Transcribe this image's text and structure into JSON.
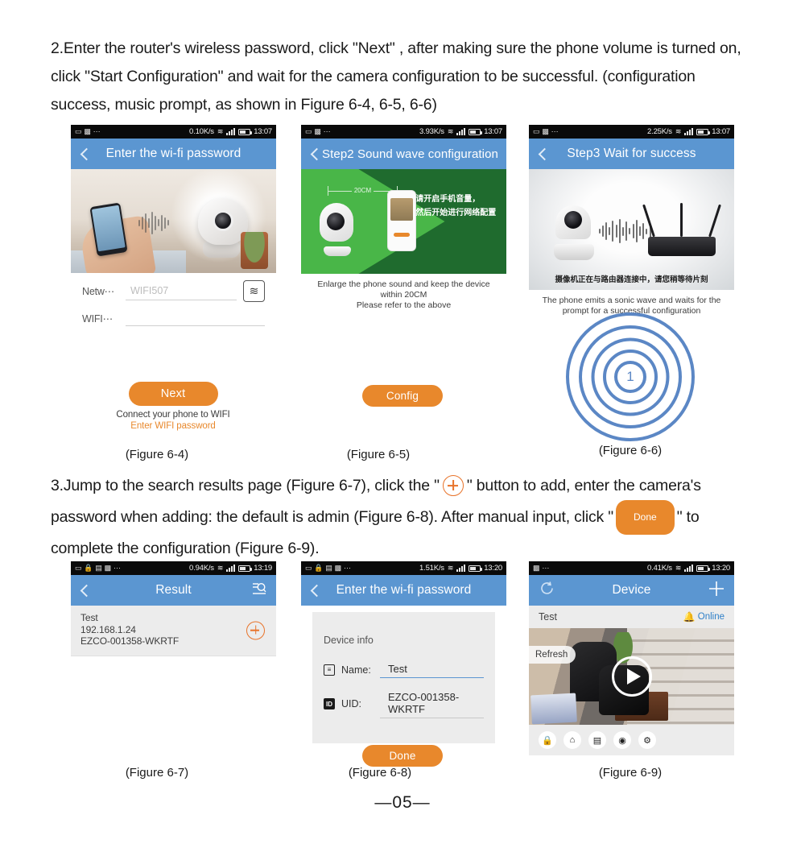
{
  "paragraphs": {
    "p2_a": "2.Enter the router's wireless password, click \"Next\" , after making sure the phone volume is turned on, click \"Start Configuration\" and wait for the camera configuration to be successful. (configuration success, music prompt, as shown in Figure 6-4, 6-5, 6-6)",
    "p3_a": "3.Jump to the search results page (Figure 6-7), click the \"",
    "p3_b": "\" button to add, enter the camera's password when adding: the default is admin (Figure 6-8). After manual input, click \"",
    "p3_done": "Done",
    "p3_c": "\" to complete the configuration  (Figure 6-9)."
  },
  "page_number": "05",
  "colors": {
    "nav_blue": "#5b96d1",
    "accent_orange": "#e8882c",
    "plus_orange": "#e8732a",
    "ripple_blue": "#5b87c5",
    "green_light": "#49b648",
    "green_dark": "#1f6b2e"
  },
  "figures": {
    "fig64": {
      "caption": "(Figure 6-4)",
      "statusbar": {
        "rate": "0.10K/s",
        "time": "13:07",
        "wifi_icon": "wifi-icon",
        "signal_icon": "signal-bars-icon",
        "battery_icon": "battery-icon"
      },
      "navbar": {
        "title": "Enter the wi-fi password",
        "back_icon": "back-chevron-icon"
      },
      "form": {
        "row1_label": "Netw⋯",
        "row1_value": "WIFI507",
        "row1_button_icon": "wifi-scan-icon",
        "row2_label": "WIFI⋯",
        "row2_value": ""
      },
      "cta": {
        "label": "Next",
        "sub1": "Connect your phone to WIFI",
        "sub2": "Enter WIFI password"
      }
    },
    "fig65": {
      "caption": "(Figure 6-5)",
      "statusbar": {
        "rate": "3.93K/s",
        "time": "13:07"
      },
      "navbar": {
        "title": "Step2 Sound wave configuration",
        "back_icon": "back-chevron-icon"
      },
      "panel": {
        "distance_label": "20CM",
        "cn_line1": "请开启手机音量，",
        "cn_line2": "然后开始进行网络配置"
      },
      "caption_lines": [
        "Enlarge the phone sound and keep the device within 20CM",
        "Please refer to the above"
      ],
      "cta": {
        "label": "Config"
      }
    },
    "fig66": {
      "caption": "(Figure 6-6)",
      "statusbar": {
        "rate": "2.25K/s",
        "time": "13:07"
      },
      "navbar": {
        "title": "Step3 Wait for success",
        "back_icon": "back-chevron-icon"
      },
      "panel": {
        "cn_line": "摄像机正在与路由器连接中，请您稍等待片刻"
      },
      "caption_lines": [
        "The phone emits a sonic wave and waits for the",
        "prompt for a successful configuration"
      ],
      "ripple_number": "1"
    },
    "fig67": {
      "caption": "(Figure 6-7)",
      "statusbar": {
        "rate": "0.94K/s",
        "time": "13:19"
      },
      "navbar": {
        "title": "Result",
        "back_icon": "back-chevron-icon",
        "right_icon": "search-list-icon"
      },
      "result": {
        "name": "Test",
        "ip": "192.168.1.24",
        "uid": "EZCO-001358-WKRTF",
        "add_icon": "plus-circle-icon"
      }
    },
    "fig68": {
      "caption": "(Figure 6-8)",
      "statusbar": {
        "rate": "1.51K/s",
        "time": "13:20"
      },
      "navbar": {
        "title": "Enter the wi-fi password",
        "back_icon": "back-chevron-icon"
      },
      "device_info": {
        "section_title": "Device info",
        "name_label": "Name:",
        "name_value": "Test",
        "name_icon": "name-field-icon",
        "uid_label": "UID:",
        "uid_value": "EZCO-001358-WKRTF",
        "uid_icon": "id-badge-icon"
      },
      "cta": {
        "label": "Done"
      }
    },
    "fig69": {
      "caption": "(Figure 6-9)",
      "statusbar": {
        "rate": "0.41K/s",
        "time": "13:20"
      },
      "navbar": {
        "title": "Device",
        "left_icon": "refresh-icon",
        "right_icon": "plus-icon"
      },
      "device": {
        "name": "Test",
        "status": "Online",
        "status_icon": "bell-icon",
        "refresh_label": "Refresh",
        "play_icon": "play-icon"
      },
      "toolbar_icons": [
        "lock-icon",
        "home-alarm-icon",
        "calendar-clock-icon",
        "eye-off-icon",
        "gear-icon"
      ]
    }
  }
}
